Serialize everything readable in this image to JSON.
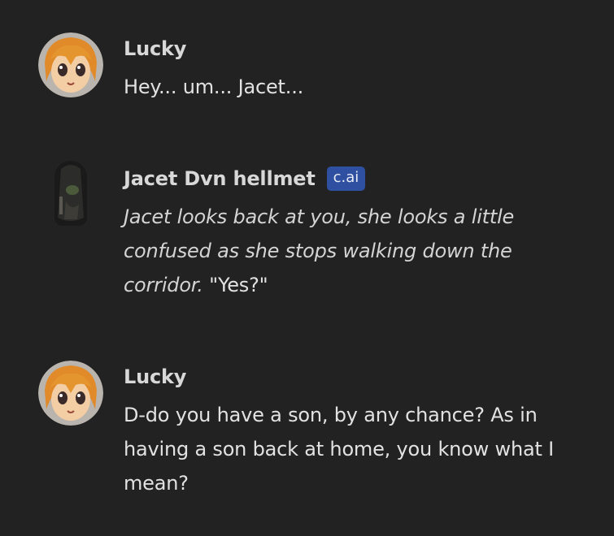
{
  "messages": [
    {
      "author": "Lucky",
      "avatar_icon": "anime-girl-avatar-icon",
      "text": "Hey... um... Jacet..."
    },
    {
      "author": "Jacet Dvn hellmet",
      "badge": "c.ai",
      "avatar_icon": "hooded-figure-avatar-icon",
      "text_italic": "Jacet looks back at you, she looks a little confused as she stops walking down the corridor.",
      "text_plain": " \"Yes?\""
    },
    {
      "author": "Lucky",
      "avatar_icon": "anime-girl-avatar-icon",
      "text": "D-do you have a son, by any chance? As in having a son back at home, you know what I mean?"
    }
  ],
  "colors": {
    "background": "#222222",
    "badge": "#2f4fa0"
  }
}
